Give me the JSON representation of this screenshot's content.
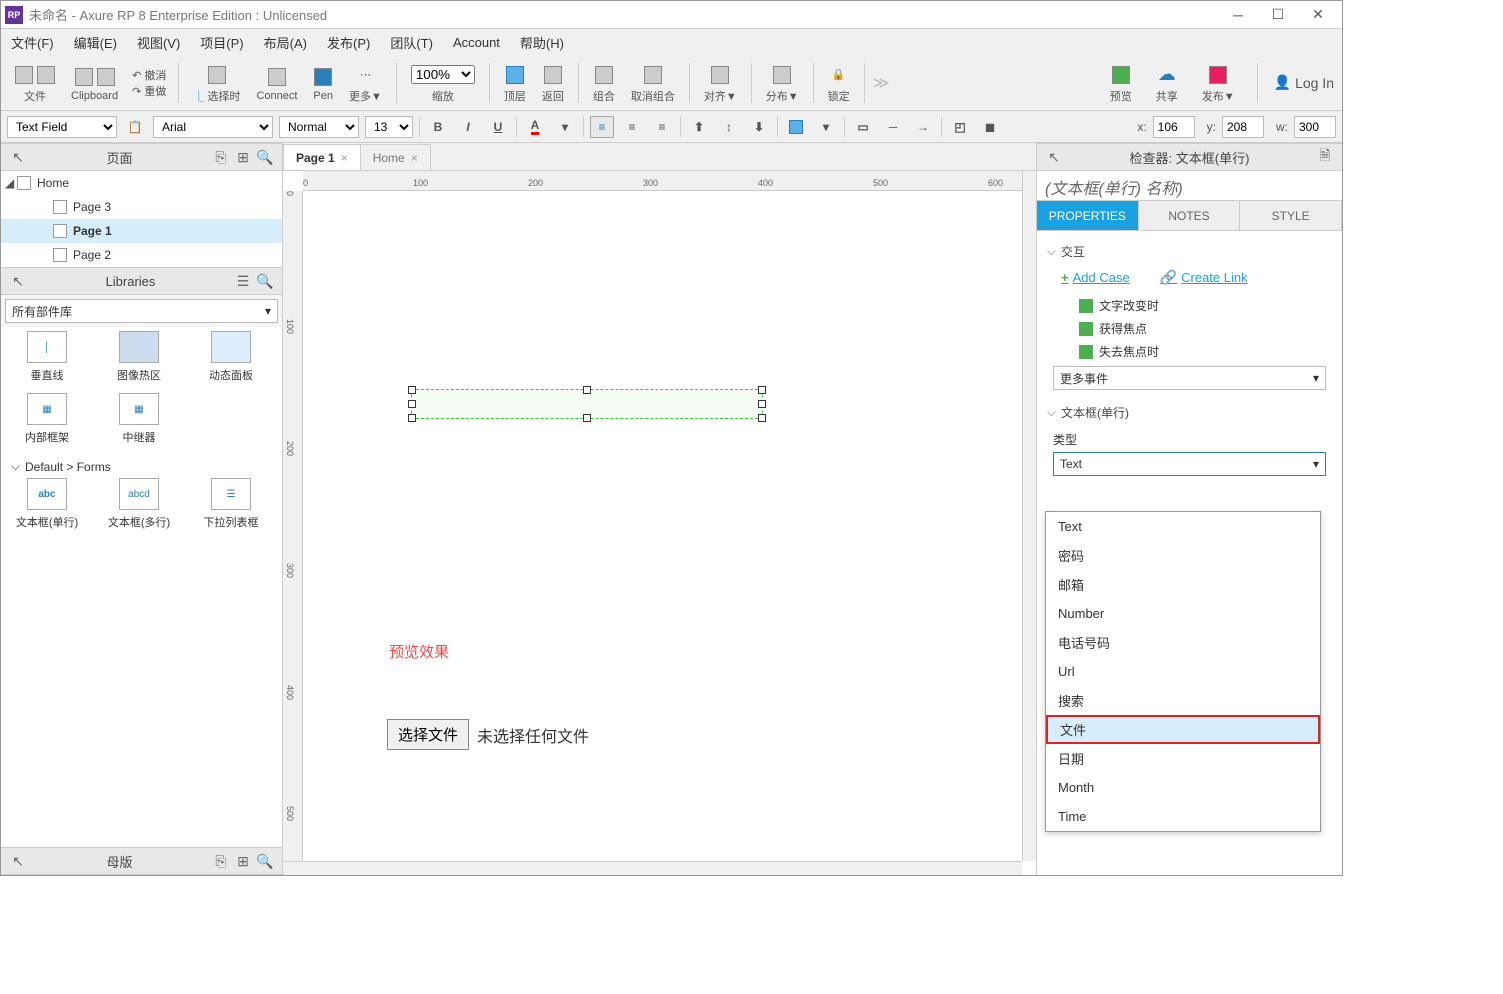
{
  "title": "未命名 - Axure RP 8 Enterprise Edition : Unlicensed",
  "menu": [
    "文件(F)",
    "编辑(E)",
    "视图(V)",
    "项目(P)",
    "布局(A)",
    "发布(P)",
    "团队(T)",
    "Account",
    "帮助(H)"
  ],
  "toolbar": {
    "file": "文件",
    "clipboard": "Clipboard",
    "undo": "撤消",
    "redo": "重做",
    "select": "选择时",
    "connect": "Connect",
    "pen": "Pen",
    "more": "更多▼",
    "zoom": "100%",
    "zoom_label": "缩放",
    "top": "顶层",
    "back": "返回",
    "group": "组合",
    "ungroup": "取消组合",
    "align": "对齐▼",
    "distribute": "分布▼",
    "lock": "锁定",
    "preview": "预览",
    "share": "共享",
    "publish": "发布▼",
    "login": "Log In"
  },
  "formatbar": {
    "widget": "Text Field",
    "font": "Arial",
    "weight": "Normal",
    "size": "13",
    "x_label": "x:",
    "y_label": "y:",
    "w_label": "w:",
    "x": "106",
    "y": "208",
    "w": "300"
  },
  "left": {
    "pages_title": "页面",
    "pages": [
      {
        "label": "Home",
        "level": 0,
        "expanded": true,
        "selected": false
      },
      {
        "label": "Page 3",
        "level": 1,
        "selected": false
      },
      {
        "label": "Page 1",
        "level": 1,
        "selected": true,
        "bold": true
      },
      {
        "label": "Page 2",
        "level": 1,
        "selected": false
      }
    ],
    "libraries_title": "Libraries",
    "library_select": "所有部件库",
    "lib_items_row1": [
      "垂直线",
      "图像热区",
      "动态面板"
    ],
    "lib_items_row2": [
      "内部框架",
      "中继器"
    ],
    "forms_cat": "Default > Forms",
    "forms_items": [
      "文本框(单行)",
      "文本框(多行)",
      "下拉列表框"
    ],
    "forms_abc": "abc",
    "forms_abcd": "abcd",
    "masters_title": "母版"
  },
  "canvas": {
    "tabs": [
      {
        "label": "Page 1",
        "active": true
      },
      {
        "label": "Home",
        "active": false
      }
    ],
    "red_text": "预览效果",
    "file_button": "选择文件",
    "file_status": "未选择任何文件",
    "hruler": [
      "0",
      "100",
      "200",
      "300",
      "400",
      "500",
      "600"
    ],
    "vruler": [
      "0",
      "100",
      "200",
      "300",
      "400",
      "500"
    ]
  },
  "inspector": {
    "head": "检查器: 文本框(单行)",
    "name_placeholder": "(文本框(单行) 名称)",
    "tabs": [
      "PROPERTIES",
      "NOTES",
      "STYLE"
    ],
    "interact_section": "交互",
    "add_case": "Add Case",
    "create_link": "Create Link",
    "events": [
      "文字改变时",
      "获得焦点",
      "失去焦点时"
    ],
    "more_events": "更多事件",
    "widget_section": "文本框(单行)",
    "type_label": "类型",
    "type_value": "Text",
    "type_options": [
      "Text",
      "密码",
      "邮箱",
      "Number",
      "电话号码",
      "Url",
      "搜索",
      "文件",
      "日期",
      "Month",
      "Time"
    ]
  }
}
